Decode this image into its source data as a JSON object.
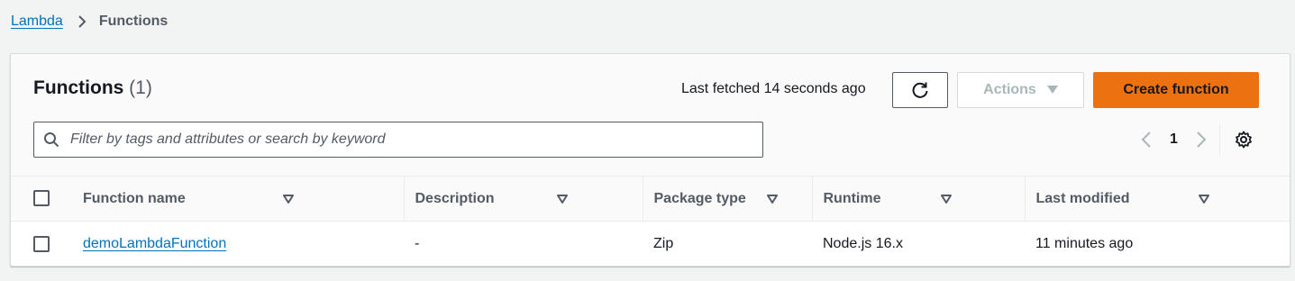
{
  "breadcrumb": {
    "parent": "Lambda",
    "current": "Functions"
  },
  "panel": {
    "title": "Functions",
    "count": "(1)",
    "last_fetched": "Last fetched 14 seconds ago",
    "actions_label": "Actions",
    "create_label": "Create function"
  },
  "search": {
    "placeholder": "Filter by tags and attributes or search by keyword",
    "value": ""
  },
  "pagination": {
    "current_page": "1"
  },
  "table": {
    "columns": [
      "Function name",
      "Description",
      "Package type",
      "Runtime",
      "Last modified"
    ],
    "rows": [
      {
        "name": "demoLambdaFunction",
        "description": "-",
        "package_type": "Zip",
        "runtime": "Node.js 16.x",
        "last_modified": "11 minutes ago"
      }
    ]
  },
  "colors": {
    "link": "#0073bb",
    "primary": "#ec7211",
    "text": "#16191f",
    "muted": "#545b64"
  },
  "icons": [
    "chevron-right-icon",
    "refresh-icon",
    "caret-down-icon",
    "search-icon",
    "chevron-left-icon",
    "settings-gear-icon",
    "sort-caret-icon"
  ]
}
